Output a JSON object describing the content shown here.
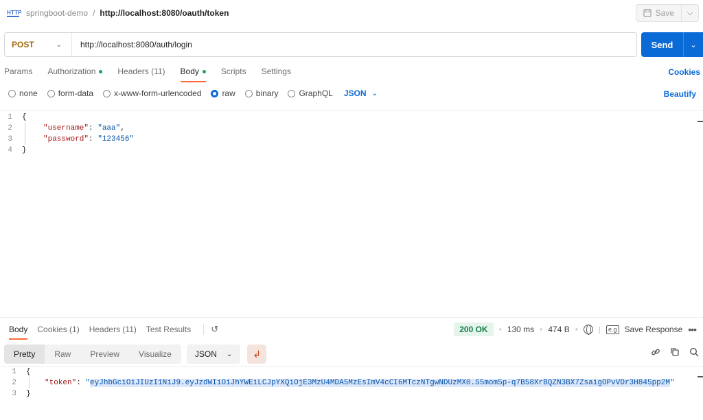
{
  "header": {
    "app_icon": "HTTP",
    "breadcrumb_parent": "springboot-demo",
    "breadcrumb_separator": "/",
    "breadcrumb_current": "http://localhost:8080/oauth/token",
    "save_label": "Save"
  },
  "request": {
    "method": "POST",
    "url": "http://localhost:8080/auth/login",
    "send_label": "Send",
    "tabs": [
      {
        "label": "Params"
      },
      {
        "label": "Authorization"
      },
      {
        "label": "Headers (11)"
      },
      {
        "label": "Body"
      },
      {
        "label": "Scripts"
      },
      {
        "label": "Settings"
      }
    ],
    "cookies_label": "Cookies",
    "body_types": [
      "none",
      "form-data",
      "x-www-form-urlencoded",
      "raw",
      "binary",
      "GraphQL"
    ],
    "selected_body_type": "raw",
    "format": "JSON",
    "beautify_label": "Beautify",
    "body_lines": {
      "l1": "1",
      "l2": "2",
      "l3": "3",
      "l4": "4",
      "open": "{",
      "k_username": "\"username\"",
      "v_username": "\"aaa\"",
      "k_password": "\"password\"",
      "v_password": "\"123456\"",
      "close": "}"
    }
  },
  "response": {
    "tabs": [
      {
        "label": "Body"
      },
      {
        "label": "Cookies (1)"
      },
      {
        "label": "Headers (11)"
      },
      {
        "label": "Test Results"
      }
    ],
    "status": "200 OK",
    "time": "130 ms",
    "size": "474 B",
    "save_response_label": "Save Response",
    "save_response_icon": "e.g",
    "view_modes": [
      "Pretty",
      "Raw",
      "Preview",
      "Visualize"
    ],
    "format": "JSON",
    "body_lines": {
      "l1": "1",
      "l2": "2",
      "l3": "3",
      "open": "{",
      "k_token": "\"token\"",
      "v_token": "eyJhbGciOiJIUzI1NiJ9.eyJzdWIiOiJhYWEiLCJpYXQiOjE3MzU4MDA5MzEsImV4cCI6MTczNTgwNDUzMX0.S5mom5p-q7B58XrBQZN3BX7ZsaigOPvVDr3H845pp2M",
      "close": "}"
    }
  }
}
